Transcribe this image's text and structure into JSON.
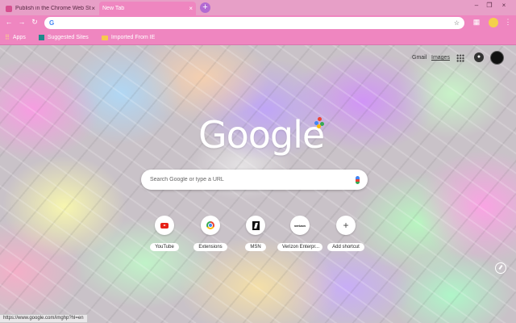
{
  "tabs": [
    {
      "title": "Publish in the Chrome Web Store",
      "close": "×"
    },
    {
      "title": "New Tab",
      "close": "×"
    }
  ],
  "newtab_label": "+",
  "window_controls": {
    "minimize": "–",
    "maximize": "❐",
    "close": "×"
  },
  "toolbar": {
    "back": "←",
    "forward": "→",
    "reload": "↻",
    "omnibox_icon": "G",
    "star": "☆",
    "menu": "⋮"
  },
  "bookmarks": [
    {
      "label": "Apps",
      "icon": "apps-icon"
    },
    {
      "label": "Suggested Sites",
      "icon": "suggested-sites-icon"
    },
    {
      "label": "Imported From IE",
      "icon": "folder-icon"
    }
  ],
  "header_links": {
    "gmail": "Gmail",
    "images": "Images"
  },
  "logo_text": "Google",
  "search": {
    "placeholder": "Search Google or type a URL"
  },
  "shortcuts": [
    {
      "label": "YouTube",
      "icon": "youtube-icon"
    },
    {
      "label": "Extensions",
      "icon": "chrome-icon"
    },
    {
      "label": "MSN",
      "icon": "msn-icon"
    },
    {
      "label": "Verizon Enterpr...",
      "icon": "verizon-icon",
      "icon_text": "verizon"
    },
    {
      "label": "Add shortcut",
      "icon": "plus-icon",
      "icon_text": "+"
    }
  ],
  "status_url": "https://www.google.com/imghp?hl=en",
  "colors": {
    "tabstrip": "#e79fc7",
    "toolbar": "#ef86c0",
    "accent": "#b36ad2"
  }
}
